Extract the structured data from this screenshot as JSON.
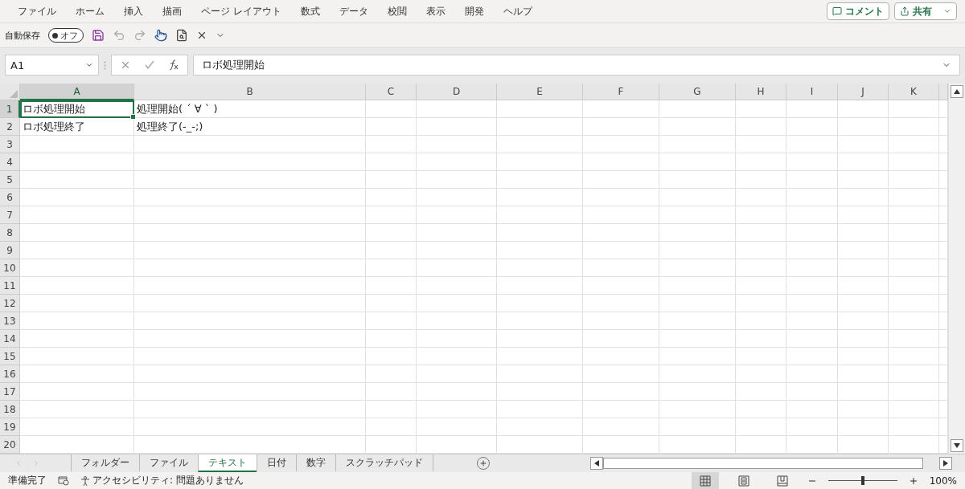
{
  "menu_tabs": [
    "ファイル",
    "ホーム",
    "挿入",
    "描画",
    "ページ レイアウト",
    "数式",
    "データ",
    "校閲",
    "表示",
    "開発",
    "ヘルプ"
  ],
  "header_buttons": {
    "comment": "コメント",
    "share": "共有"
  },
  "quick_access": {
    "autosave_label": "自動保存",
    "autosave_toggle": {
      "label": "オフ",
      "on": false
    }
  },
  "formula_bar": {
    "name_box": "A1",
    "formula": "ロボ処理開始"
  },
  "grid": {
    "columns": [
      {
        "label": "A",
        "selected": true
      },
      {
        "label": "B",
        "selected": false
      },
      {
        "label": "C",
        "selected": false
      },
      {
        "label": "D",
        "selected": false
      },
      {
        "label": "E",
        "selected": false
      },
      {
        "label": "F",
        "selected": false
      },
      {
        "label": "G",
        "selected": false
      },
      {
        "label": "H",
        "selected": false
      },
      {
        "label": "I",
        "selected": false
      },
      {
        "label": "J",
        "selected": false
      },
      {
        "label": "K",
        "selected": false
      }
    ],
    "rows": [
      {
        "header": "1",
        "selected": true,
        "cells": [
          {
            "text": "ロボ処理開始",
            "selected": true
          },
          {
            "text": "処理開始( ´ ∀ ` )",
            "selected": false
          }
        ]
      },
      {
        "header": "2",
        "selected": false,
        "cells": [
          {
            "text": "ロボ処理終了",
            "selected": false
          },
          {
            "text": "処理終了(-_-;)",
            "selected": false
          }
        ]
      },
      {
        "header": "3",
        "selected": false
      },
      {
        "header": "4",
        "selected": false
      },
      {
        "header": "5",
        "selected": false
      },
      {
        "header": "6",
        "selected": false
      },
      {
        "header": "7",
        "selected": false
      },
      {
        "header": "8",
        "selected": false
      },
      {
        "header": "9",
        "selected": false
      },
      {
        "header": "10",
        "selected": false
      },
      {
        "header": "11",
        "selected": false
      },
      {
        "header": "12",
        "selected": false
      },
      {
        "header": "13",
        "selected": false
      },
      {
        "header": "14",
        "selected": false
      },
      {
        "header": "15",
        "selected": false
      },
      {
        "header": "16",
        "selected": false
      },
      {
        "header": "17",
        "selected": false
      },
      {
        "header": "18",
        "selected": false
      },
      {
        "header": "19",
        "selected": false
      },
      {
        "header": "20",
        "selected": false
      }
    ]
  },
  "sheet_tabs": [
    {
      "label": "フォルダー",
      "selected": false
    },
    {
      "label": "ファイル",
      "selected": false
    },
    {
      "label": "テキスト",
      "selected": true
    },
    {
      "label": "日付",
      "selected": false
    },
    {
      "label": "数字",
      "selected": false
    },
    {
      "label": "スクラッチパッド",
      "selected": false
    }
  ],
  "status_bar": {
    "status": "準備完了",
    "accessibility": "アクセシビリティ: 問題ありません",
    "views": [
      {
        "kind": "normal",
        "selected": true
      },
      {
        "kind": "page_layout",
        "selected": false
      },
      {
        "kind": "page_break",
        "selected": false
      }
    ],
    "zoom": {
      "level": 0.5,
      "label": "100%"
    }
  }
}
